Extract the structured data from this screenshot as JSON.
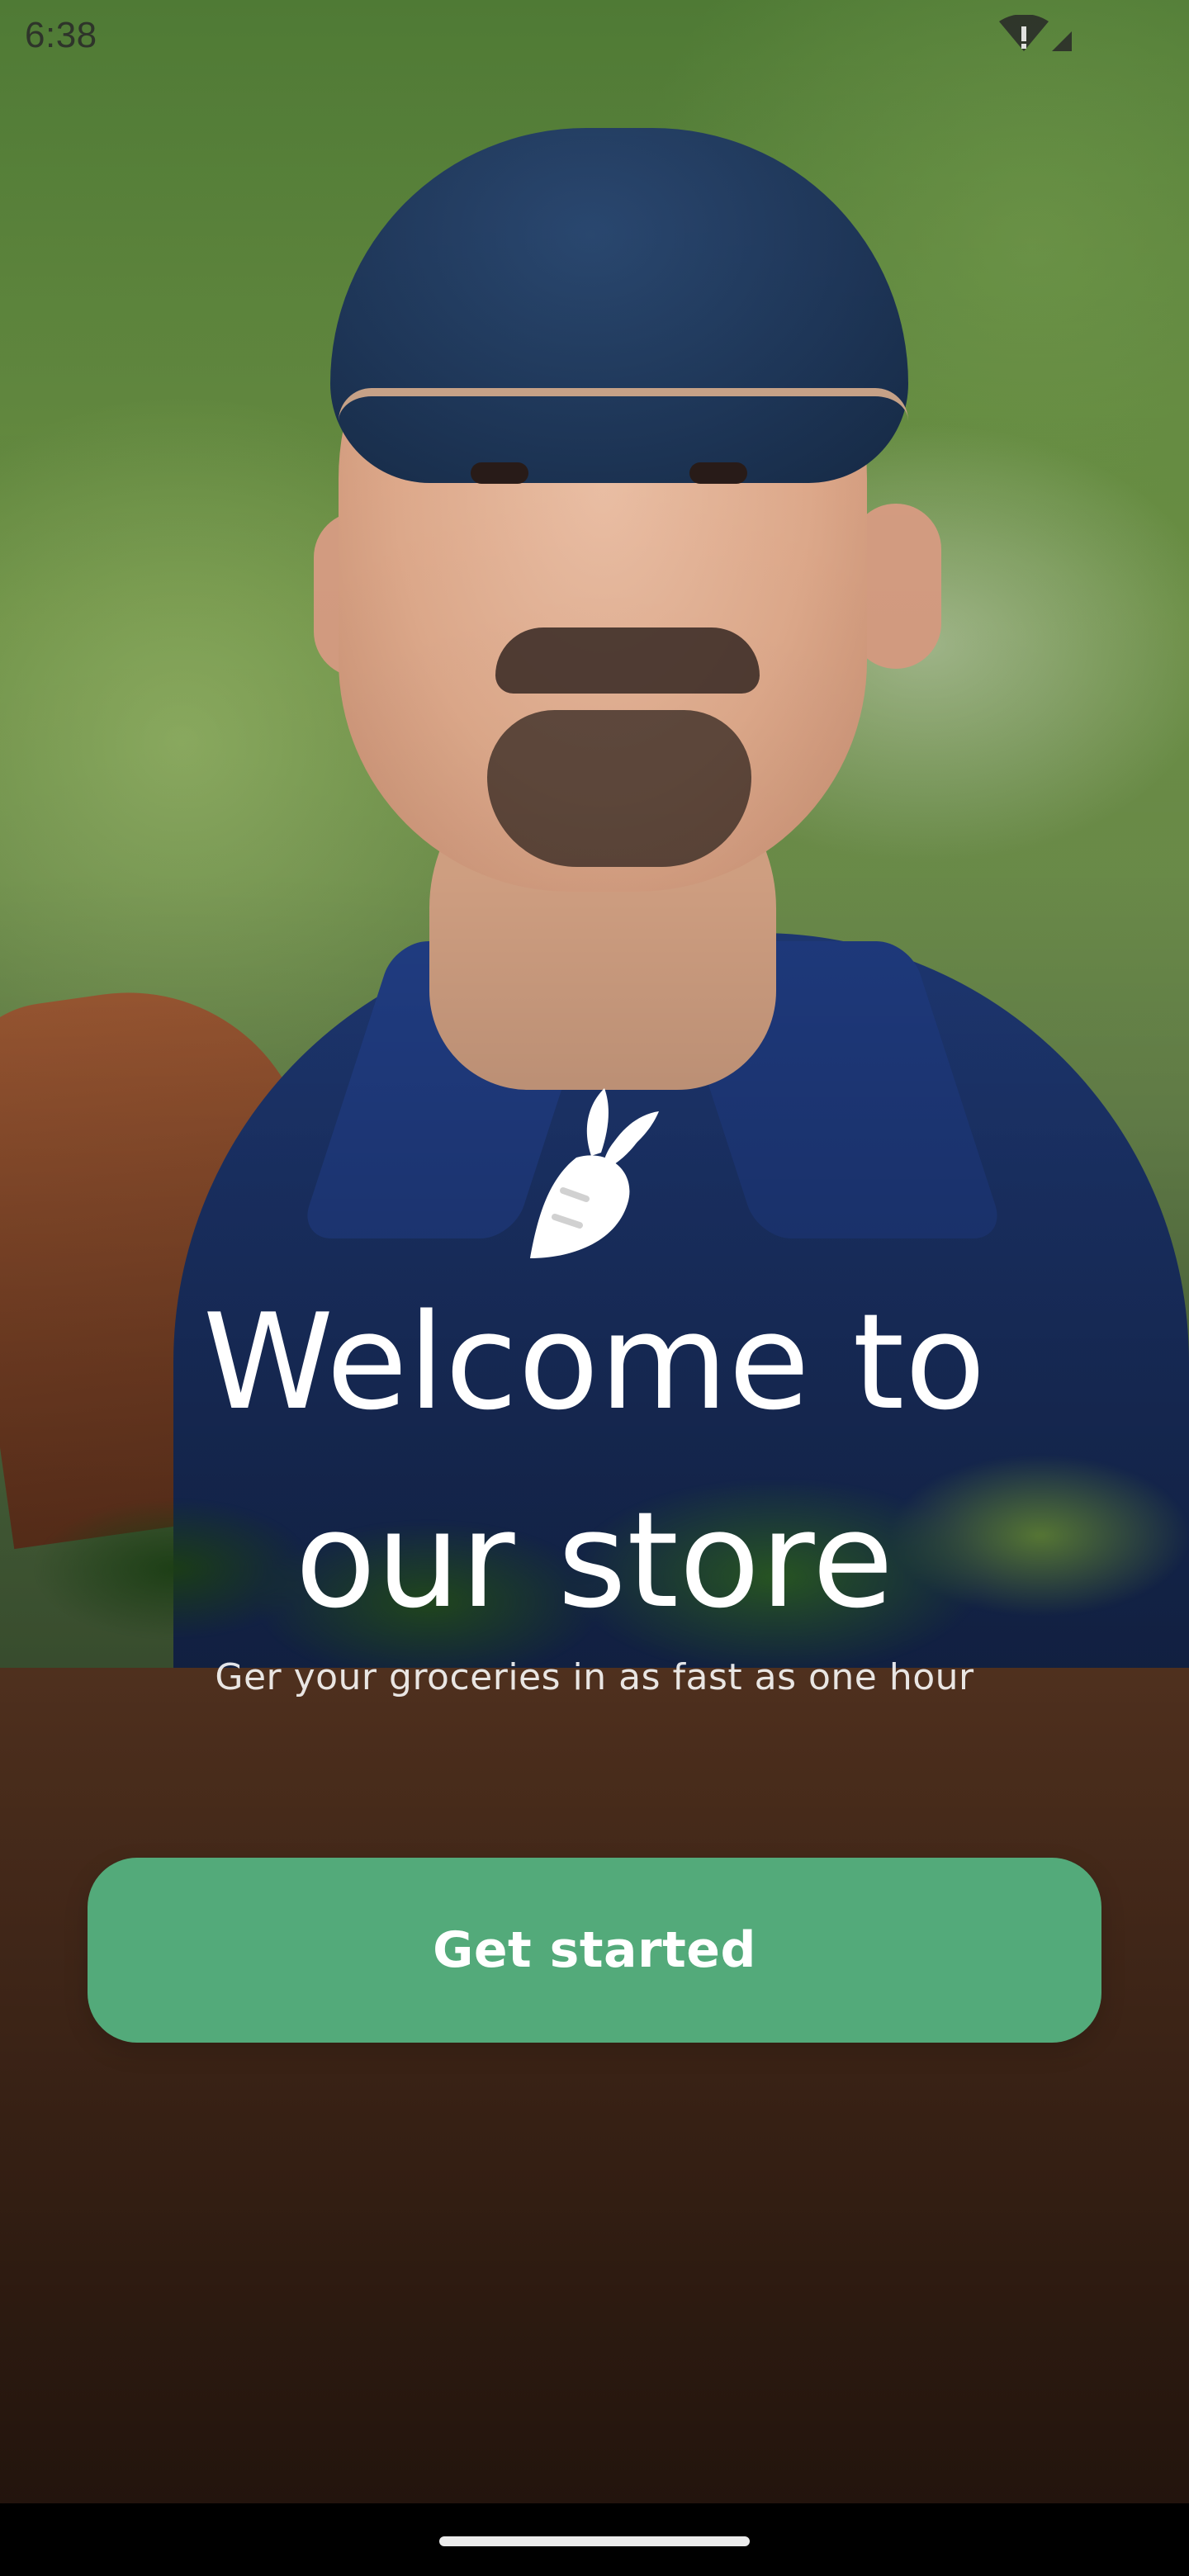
{
  "status_bar": {
    "time": "6:38",
    "icons": [
      "wifi-alert-icon",
      "cell-signal-icon"
    ]
  },
  "brand": {
    "logo_icon": "carrot-icon"
  },
  "welcome": {
    "title_line1": "Welcome to",
    "title_line2": "our store",
    "subtitle": "Ger your groceries in as fast as one hour"
  },
  "cta": {
    "label": "Get started"
  },
  "colors": {
    "accent": "#53aa7a",
    "text": "#ffffff"
  }
}
